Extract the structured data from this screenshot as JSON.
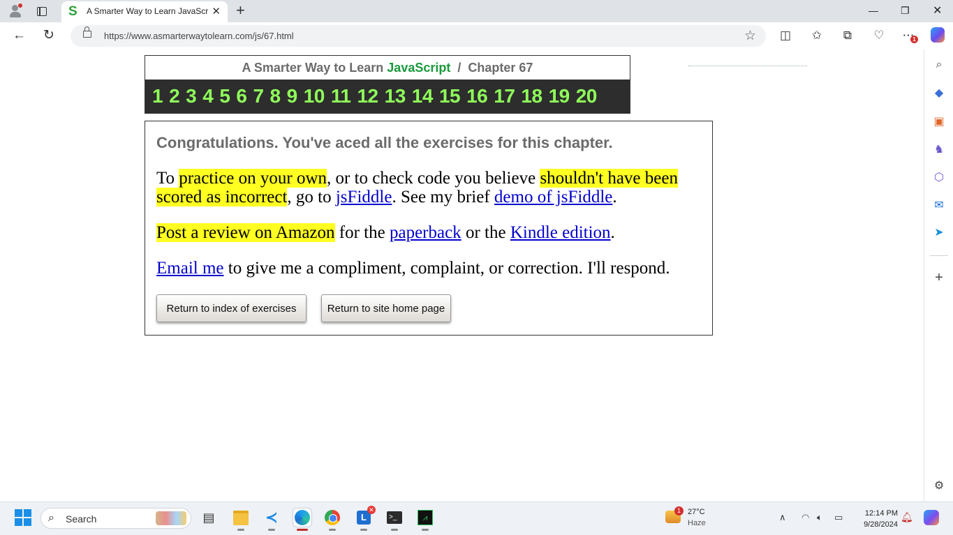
{
  "browser": {
    "tab_title": "A Smarter Way to Learn JavaScript",
    "tab_favicon": "S",
    "url": "https://www.asmarterwaytolearn.com/js/67.html",
    "ext_badge": "1"
  },
  "page": {
    "header": {
      "title_prefix": "A Smarter Way to Learn",
      "title_js": "JavaScript",
      "title_sep": "/",
      "title_chapter": "Chapter 67"
    },
    "chapters": [
      "1",
      "2",
      "3",
      "4",
      "5",
      "6",
      "7",
      "8",
      "9",
      "10",
      "11",
      "12",
      "13",
      "14",
      "15",
      "16",
      "17",
      "18",
      "19",
      "20"
    ],
    "congrats": "Congratulations. You've aced all the exercises for this chapter.",
    "p1": {
      "t1": "To ",
      "h1": "practice on your own",
      "t2": ", or to check code you believe ",
      "h2": "shouldn't have been scored as incorrect",
      "t3": ", go to ",
      "l1": "jsFiddle",
      "t4": ". See my brief ",
      "l2": "demo of jsFiddle",
      "t5": "."
    },
    "p2": {
      "h1": "Post a review on Amazon",
      "t1": " for the ",
      "l1": "paperback",
      "t2": " or the ",
      "l2": "Kindle edition",
      "t3": "."
    },
    "p3": {
      "l1": "Email me",
      "t1": " to give me a compliment, complaint, or correction. I'll respond."
    },
    "buttons": {
      "index": "Return to index of exercises",
      "home": "Return to site home page"
    }
  },
  "taskbar": {
    "search_placeholder": "Search",
    "weather_temp": "27°C",
    "weather_cond": "Haze",
    "weather_badge": "1",
    "time": "12:14 PM",
    "date": "9/28/2024"
  }
}
